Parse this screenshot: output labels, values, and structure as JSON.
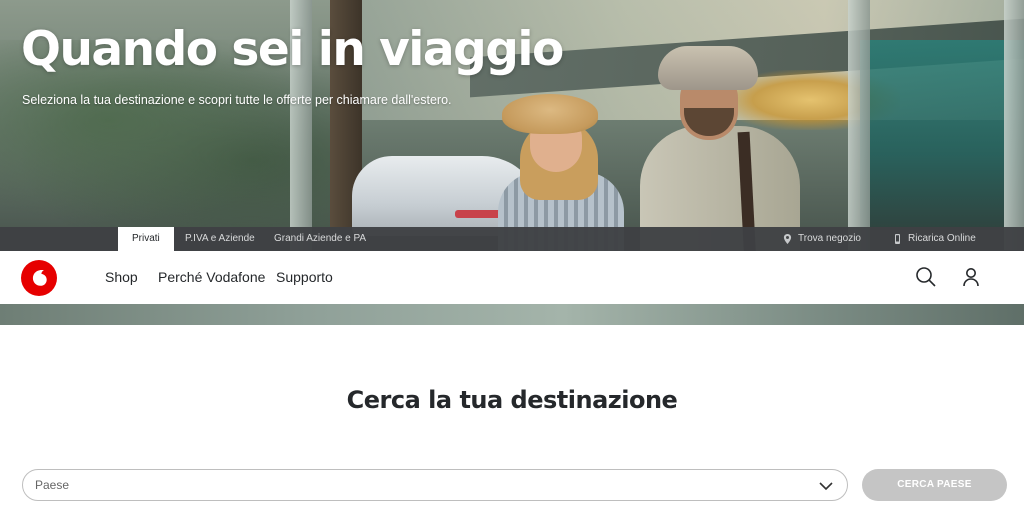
{
  "hero": {
    "title": "Quando sei in viaggio",
    "subtitle": "Seleziona la tua destinazione e scopri tutte le offerte per chiamare dall'estero."
  },
  "segments": {
    "items": [
      {
        "label": "Privati",
        "active": true
      },
      {
        "label": "P.IVA e Aziende",
        "active": false
      },
      {
        "label": "Grandi Aziende e PA",
        "active": false
      }
    ],
    "right": [
      {
        "label": "Trova negozio",
        "icon": "location-pin-icon"
      },
      {
        "label": "Ricarica Online",
        "icon": "phone-topup-icon"
      }
    ]
  },
  "nav": {
    "links": [
      "Shop",
      "Perché Vodafone",
      "Supporto"
    ],
    "icons": [
      "search-icon",
      "user-icon"
    ],
    "brand_color": "#e60000"
  },
  "search": {
    "title": "Cerca la tua destinazione",
    "placeholder": "Paese",
    "button": "CERCA PAESE"
  }
}
